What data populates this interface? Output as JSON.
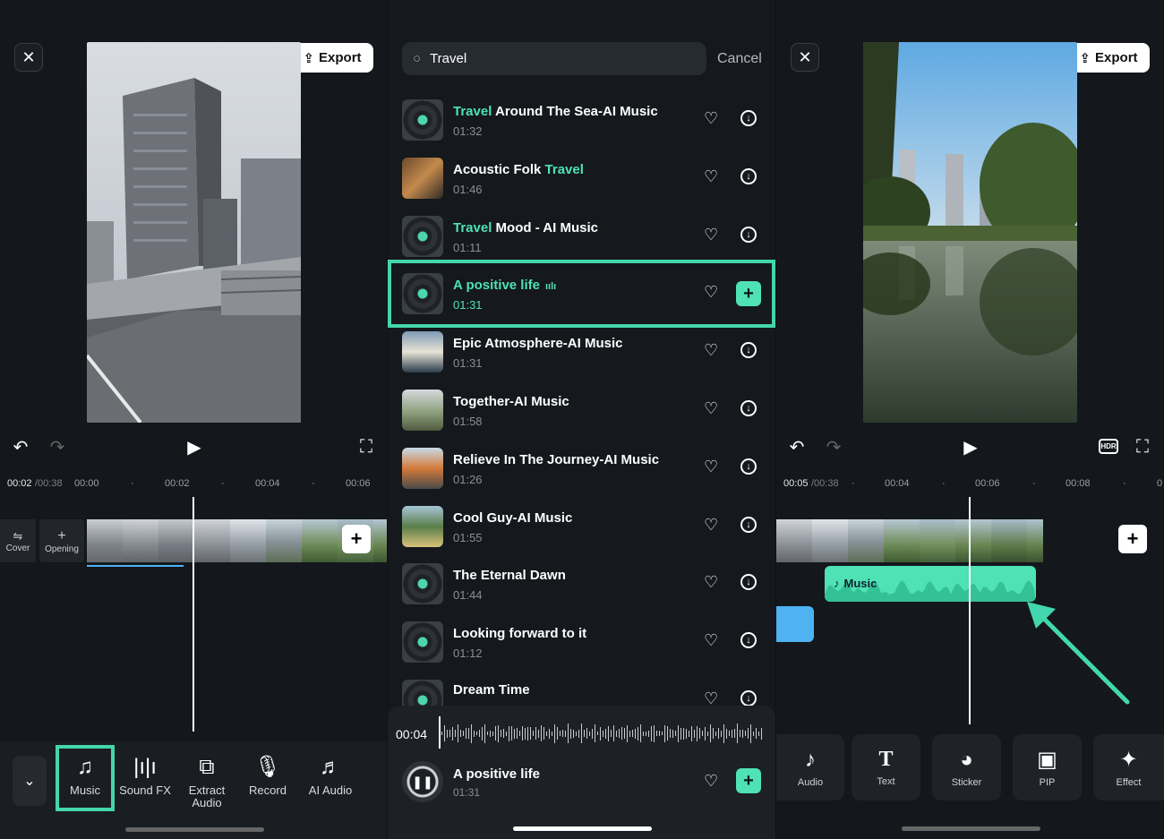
{
  "left": {
    "export_label": "Export",
    "time_current": "00:02",
    "time_total": "/00:38",
    "ticks": [
      "00:00",
      "00:02",
      "00:04",
      "00:06"
    ],
    "cover_label": "Cover",
    "opening_label": "Opening",
    "tools": [
      {
        "label": "Music",
        "icon": "music-note-icon"
      },
      {
        "label": "Sound FX",
        "icon": "sound-bars-icon"
      },
      {
        "label": "Extract\nAudio",
        "icon": "extract-audio-icon"
      },
      {
        "label": "Record",
        "icon": "microphone-icon"
      },
      {
        "label": "AI Audio",
        "icon": "ai-audio-icon"
      }
    ],
    "accent": "#43d6ae"
  },
  "middle": {
    "search_value": "Travel",
    "cancel_label": "Cancel",
    "tracks": [
      {
        "pre": "",
        "hl": "Travel",
        "post": " Around The Sea-AI Music",
        "duration": "01:32"
      },
      {
        "pre": "Acoustic Folk ",
        "hl": "Travel",
        "post": "",
        "duration": "01:46"
      },
      {
        "pre": "",
        "hl": "Travel",
        "post": " Mood - AI Music",
        "duration": "01:11"
      },
      {
        "pre": "",
        "hl": "A positive life",
        "post": "",
        "duration": "01:31"
      },
      {
        "pre": "Epic Atmosphere-AI Music",
        "hl": "",
        "post": "",
        "duration": "01:31"
      },
      {
        "pre": "Together-AI Music",
        "hl": "",
        "post": "",
        "duration": "01:58"
      },
      {
        "pre": "Relieve In The Journey-AI Music",
        "hl": "",
        "post": "",
        "duration": "01:26"
      },
      {
        "pre": "Cool Guy-AI Music",
        "hl": "",
        "post": "",
        "duration": "01:55"
      },
      {
        "pre": "The Eternal Dawn",
        "hl": "",
        "post": "",
        "duration": "01:44"
      },
      {
        "pre": "Looking forward to it",
        "hl": "",
        "post": "",
        "duration": "01:12"
      },
      {
        "pre": "Dream Time",
        "hl": "",
        "post": "",
        "duration": ""
      }
    ],
    "player": {
      "time": "00:04",
      "title": "A positive life",
      "duration": "01:31"
    },
    "highlight_color": "#4ee2b4"
  },
  "right": {
    "export_label": "Export",
    "time_current": "00:05",
    "time_total": "/00:38",
    "ticks": [
      "00:04",
      "00:06",
      "00:08",
      "0"
    ],
    "music_clip_label": "Music",
    "hdr_label": "HDR",
    "tools": [
      {
        "label": "Audio",
        "icon": "music-note-icon"
      },
      {
        "label": "Text",
        "icon": "text-icon"
      },
      {
        "label": "Sticker",
        "icon": "sticker-icon"
      },
      {
        "label": "PIP",
        "icon": "pip-icon"
      },
      {
        "label": "Effect",
        "icon": "effect-icon"
      }
    ]
  }
}
